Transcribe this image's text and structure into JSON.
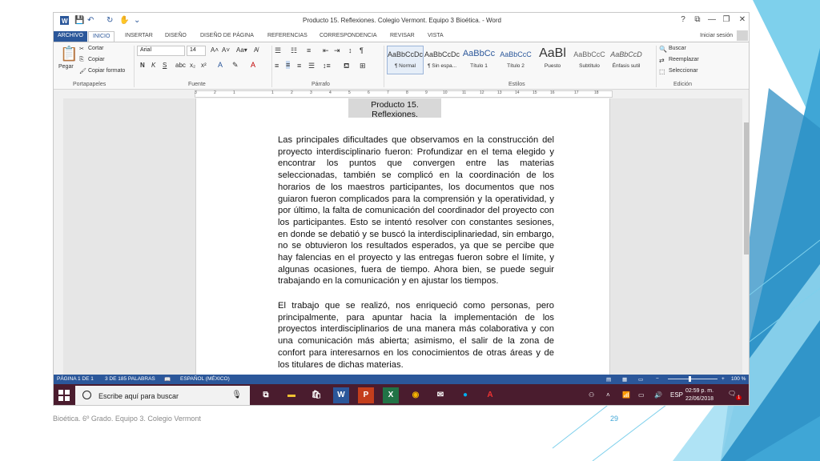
{
  "word": {
    "window_title": "Producto 15. Reflexiones. Colegio Vermont. Equipo 3 Bioética. - Word",
    "window_buttons": [
      "?",
      "⧉",
      "—",
      "❐",
      "✕"
    ],
    "tabs": [
      "ARCHIVO",
      "INICIO",
      "INSERTAR",
      "DISEÑO",
      "DISEÑO DE PÁGINA",
      "REFERENCIAS",
      "CORRESPONDENCIA",
      "REVISAR",
      "VISTA"
    ],
    "active_tab": "INICIO",
    "sign_in": "Iniciar sesión",
    "clipboard": {
      "paste": "Pegar",
      "cut": "Cortar",
      "copy": "Copiar",
      "format_painter": "Copiar formato",
      "label": "Portapapeles"
    },
    "font": {
      "family": "Arial",
      "size": "14",
      "label": "Fuente",
      "bold": "N",
      "italic": "K",
      "underline": "S"
    },
    "paragraph": {
      "label": "Párrafo"
    },
    "styles": {
      "label": "Estilos",
      "items": [
        {
          "sample": "AaBbCcDc",
          "name": "¶ Normal"
        },
        {
          "sample": "AaBbCcDc",
          "name": "¶ Sin espa..."
        },
        {
          "sample": "AaBbCc",
          "name": "Título 1"
        },
        {
          "sample": "AaBbCcC",
          "name": "Título 2"
        },
        {
          "sample": "AaBl",
          "name": "Puesto"
        },
        {
          "sample": "AaBbCcC",
          "name": "Subtítulo"
        },
        {
          "sample": "AaBbCcD",
          "name": "Énfasis sutil"
        }
      ]
    },
    "editing": {
      "find": "Buscar",
      "replace": "Reemplazar",
      "select": "Seleccionar",
      "label": "Edición"
    },
    "ruler_numbers": [
      "3",
      "2",
      "1",
      "1",
      "2",
      "3",
      "4",
      "5",
      "6",
      "7",
      "8",
      "9",
      "10",
      "11",
      "12",
      "13",
      "14",
      "15",
      "16",
      "17",
      "18"
    ],
    "document": {
      "title": "Producto 15. Reflexiones.",
      "paragraph1": "Las principales dificultades que observamos en la construcción del proyecto interdisciplinario fueron: Profundizar en el tema elegido y encontrar los puntos que convergen entre las materias seleccionadas, también se complicó en la coordinación de los horarios de los maestros participantes, los documentos que nos guiaron fueron complicados para la comprensión y la operatividad, y por último, la falta de comunicación del coordinador del proyecto con los participantes. Esto se intentó resolver con constantes sesiones, en donde se debatió y se buscó la interdisciplinariedad, sin embargo, no se obtuvieron los resultados esperados, ya que se percibe que hay falencias en el proyecto y las entregas fueron sobre el límite, y algunas ocasiones, fuera de tiempo. Ahora bien, se puede seguir trabajando en la comunicación y en ajustar los tiempos.",
      "paragraph2": "El trabajo que se realizó, nos enriqueció como personas, pero principalmente, para apuntar hacia la implementación de los proyectos interdisciplinarios de una manera más colaborativa y con una comunicación más abierta; asimismo, el salir de la zona de confort para interesarnos en los conocimientos de otras áreas y de los titulares de dichas materias."
    },
    "status": {
      "page": "PÁGINA 1 DE 1",
      "words": "3 DE 185 PALABRAS",
      "language": "ESPAÑOL (MÉXICO)",
      "zoom": "100 %"
    }
  },
  "taskbar": {
    "search_placeholder": "Escribe aquí para buscar",
    "language": "ESP",
    "time": "02:59 p. m.",
    "date": "22/06/2018",
    "notifications": "1"
  },
  "slide": {
    "footer": "Bioética. 6º Grado. Equipo 3. Colegio Vermont",
    "page_number": "29"
  },
  "colors": {
    "word_blue": "#2b579a",
    "taskbar": "#4a1c2e",
    "accent_teal": "#3fa6d6"
  }
}
